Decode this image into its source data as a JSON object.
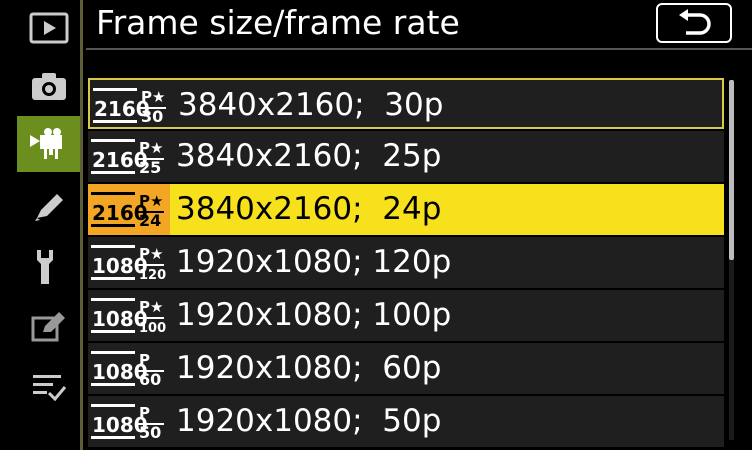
{
  "header": {
    "title": "Frame size/frame rate"
  },
  "sidebar": {
    "items": [
      {
        "icon": "playback-icon"
      },
      {
        "icon": "camera-icon"
      },
      {
        "icon": "movie-camera-icon",
        "active": true
      },
      {
        "icon": "pencil-icon"
      },
      {
        "icon": "wrench-icon"
      },
      {
        "icon": "retouch-icon"
      },
      {
        "icon": "my-menu-icon"
      }
    ]
  },
  "options": [
    {
      "res": "2160",
      "star": "P★",
      "fps": "30",
      "label": "3840x2160;  30p"
    },
    {
      "res": "2160",
      "star": "P★",
      "fps": "25",
      "label": "3840x2160;  25p"
    },
    {
      "res": "2160",
      "star": "P★",
      "fps": "24",
      "label": "3840x2160;  24p"
    },
    {
      "res": "1080",
      "star": "P★",
      "fps": "120",
      "label": "1920x1080; 120p"
    },
    {
      "res": "1080",
      "star": "P★",
      "fps": "100",
      "label": "1920x1080; 100p"
    },
    {
      "res": "1080",
      "star": "P",
      "fps": "60",
      "label": "1920x1080;  60p"
    },
    {
      "res": "1080",
      "star": "P",
      "fps": "50",
      "label": "1920x1080;  50p"
    }
  ],
  "colors": {
    "accent": "#6b8e1f",
    "selected": "#f7e11c",
    "selected_badge": "#f2a623",
    "focus_border": "#d9c84a"
  }
}
